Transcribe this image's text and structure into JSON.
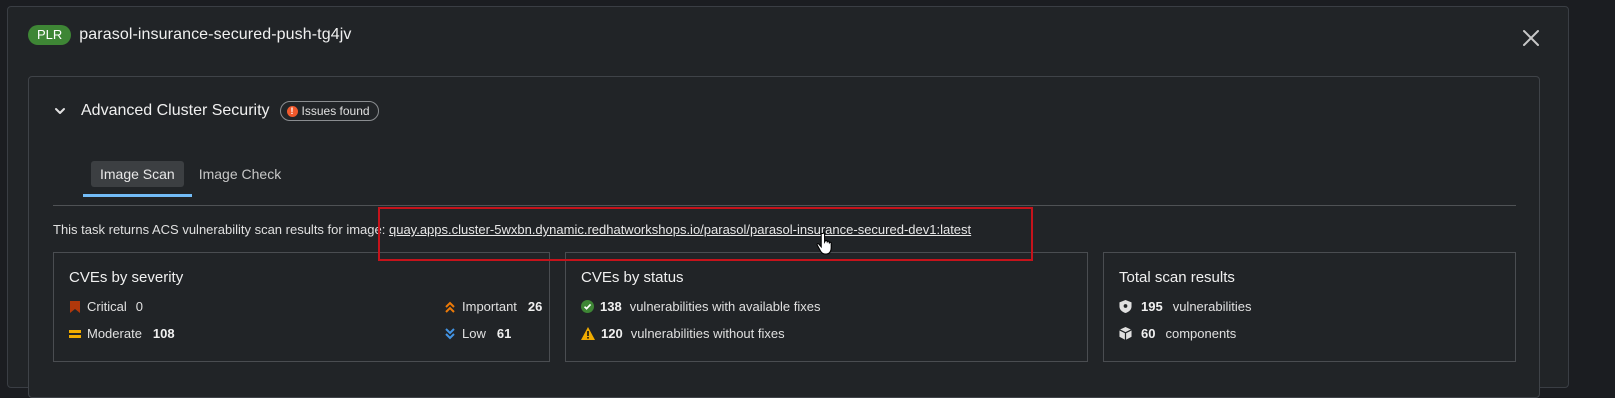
{
  "header": {
    "badge": "PLR",
    "title": "parasol-insurance-secured-push-tg4jv"
  },
  "section": {
    "title": "Advanced Cluster Security",
    "status_badge": "Issues found"
  },
  "tabs": [
    {
      "label": "Image Scan",
      "active": true
    },
    {
      "label": "Image Check",
      "active": false
    }
  ],
  "intro": {
    "text": "This task returns ACS vulnerability scan results for image:",
    "image_link": "quay.apps.cluster-5wxbn.dynamic.redhatworkshops.io/parasol/parasol-insurance-secured-dev1:latest"
  },
  "severity": {
    "title": "CVEs by severity",
    "critical_label": "Critical",
    "critical_value": "0",
    "important_label": "Important",
    "important_value": "26",
    "moderate_label": "Moderate",
    "moderate_value": "108",
    "low_label": "Low",
    "low_value": "61"
  },
  "status": {
    "title": "CVEs by status",
    "fixable_value": "138",
    "fixable_label": "vulnerabilities with available fixes",
    "unfixable_value": "120",
    "unfixable_label": "vulnerabilities without fixes"
  },
  "totals": {
    "title": "Total scan results",
    "vuln_value": "195",
    "vuln_label": "vulnerabilities",
    "comp_value": "60",
    "comp_label": "components"
  },
  "colors": {
    "plr_badge": "#3e8635",
    "critical": "#b1380b",
    "important": "#f0ab00",
    "moderate": "#f0ab00",
    "low": "#4394e5",
    "success": "#3e8635",
    "warning": "#f0ab00",
    "highlight": "#c5131b"
  },
  "icons": [
    "close-icon",
    "chevron-down-icon",
    "exclamation-circle-icon",
    "critical-icon",
    "important-icon",
    "moderate-icon",
    "low-icon",
    "check-circle-icon",
    "warning-triangle-icon",
    "shield-icon",
    "cube-icon",
    "hand-pointer-icon"
  ]
}
